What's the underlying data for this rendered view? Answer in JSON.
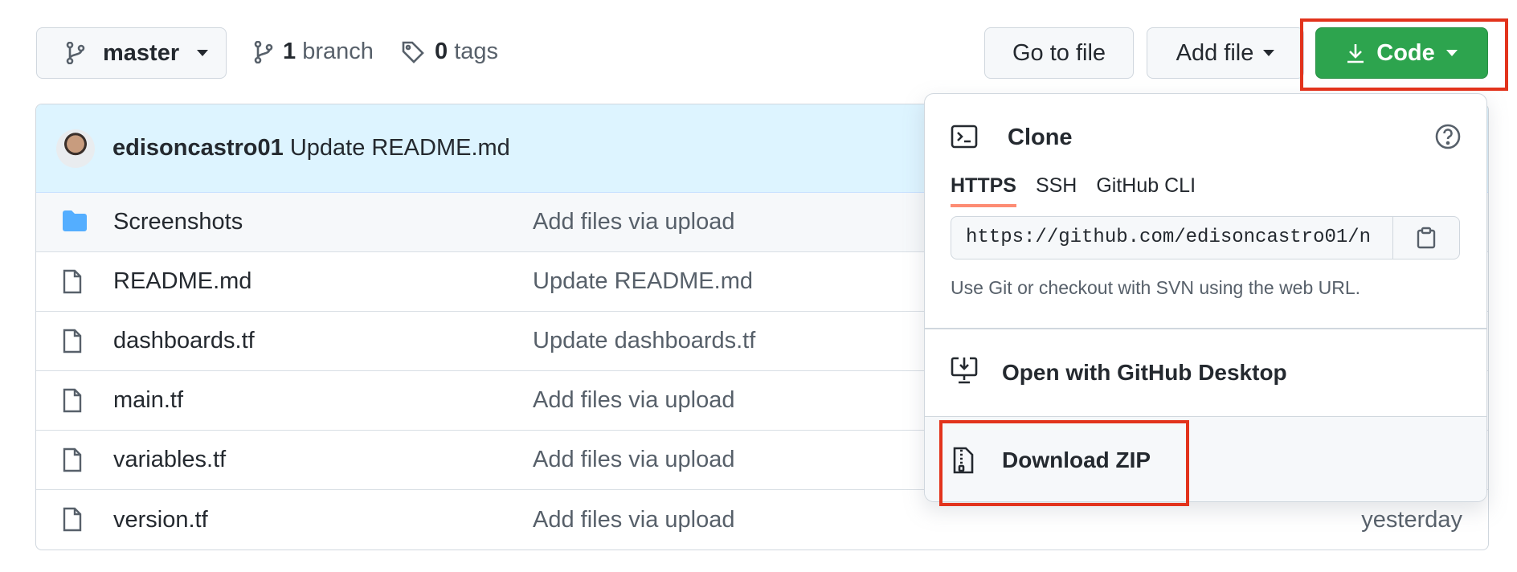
{
  "repo_bar": {
    "branch_name": "master",
    "branch_count": "1",
    "branch_label": "branch",
    "tag_count": "0",
    "tag_label": "tags",
    "go_to_file": "Go to file",
    "add_file": "Add file",
    "code": "Code"
  },
  "latest_commit": {
    "author": "edisoncastro01",
    "message": "Update README.md"
  },
  "files": [
    {
      "name": "Screenshots",
      "type": "folder",
      "message": "Add files via upload",
      "age": ""
    },
    {
      "name": "README.md",
      "type": "file",
      "message": "Update README.md",
      "age": ""
    },
    {
      "name": "dashboards.tf",
      "type": "file",
      "message": "Update dashboards.tf",
      "age": ""
    },
    {
      "name": "main.tf",
      "type": "file",
      "message": "Add files via upload",
      "age": ""
    },
    {
      "name": "variables.tf",
      "type": "file",
      "message": "Add files via upload",
      "age": ""
    },
    {
      "name": "version.tf",
      "type": "file",
      "message": "Add files via upload",
      "age": "yesterday"
    }
  ],
  "clone_panel": {
    "title": "Clone",
    "tabs": [
      "HTTPS",
      "SSH",
      "GitHub CLI"
    ],
    "active_tab": "HTTPS",
    "url": "https://github.com/edisoncastro01/n",
    "hint": "Use Git or checkout with SVN using the web URL.",
    "open_desktop": "Open with GitHub Desktop",
    "download_zip": "Download ZIP"
  },
  "colors": {
    "code_button": "#2da44e",
    "highlight": "#e2331c",
    "folder_icon": "#54aeff",
    "active_tab_underline": "#fd8c73"
  }
}
